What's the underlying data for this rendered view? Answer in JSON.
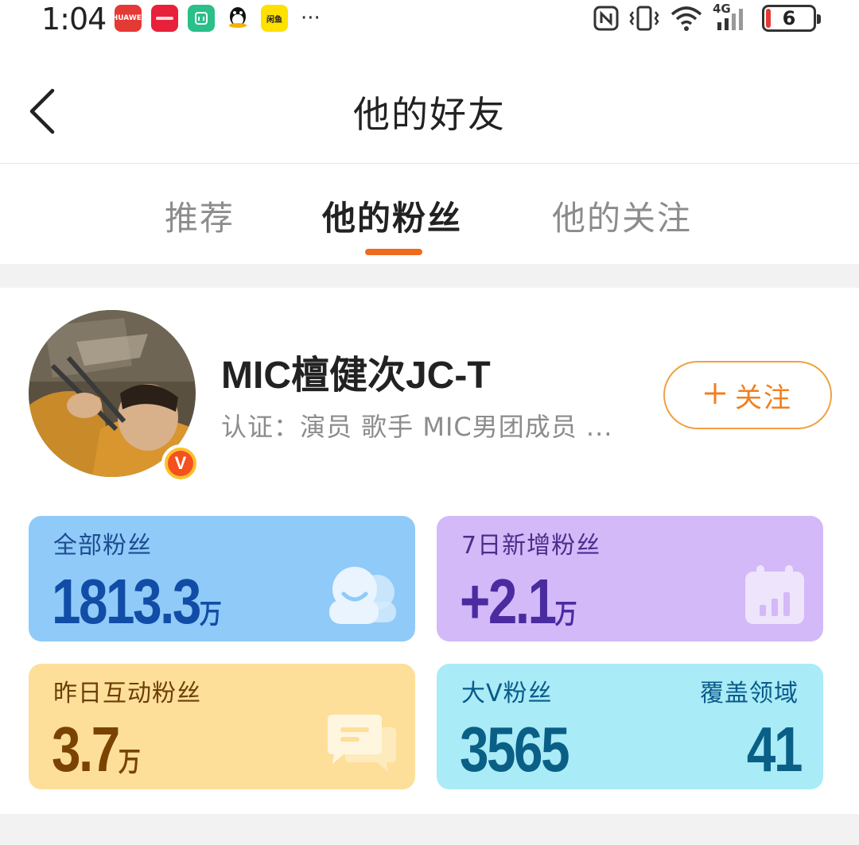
{
  "status_bar": {
    "time": "1:04",
    "app_icons": [
      {
        "name": "huawei-appgallery-icon",
        "color": "#e53935",
        "label": "HUAWEI"
      },
      {
        "name": "red-app-icon",
        "color": "#e8213b",
        "label": ""
      },
      {
        "name": "mijia-icon",
        "color": "#2bbf8a",
        "label": ""
      },
      {
        "name": "qq-icon",
        "color": "#ffffff",
        "label": ""
      },
      {
        "name": "xianyu-icon",
        "color": "#ffe100",
        "label": "闲鱼"
      }
    ],
    "more": "···",
    "network": "4G",
    "battery": "6"
  },
  "header": {
    "title": "他的好友"
  },
  "tabs": [
    {
      "label": "推荐",
      "active": false
    },
    {
      "label": "他的粉丝",
      "active": true
    },
    {
      "label": "他的关注",
      "active": false
    }
  ],
  "profile": {
    "name": "MIC檀健次JC-T",
    "verification": "认证：演员 歌手 MIC男团成员 ...",
    "badge": "V",
    "follow_label": "关注"
  },
  "stats": {
    "all_fans": {
      "label": "全部粉丝",
      "value": "1813.3",
      "unit": "万"
    },
    "new_fans_7d": {
      "label": "7日新增粉丝",
      "value": "+2.1",
      "unit": "万"
    },
    "interactive_fans": {
      "label": "昨日互动粉丝",
      "value": "3.7",
      "unit": "万"
    },
    "big_v_fans": {
      "label": "大V粉丝",
      "value": "3565",
      "coverage_label": "覆盖领域",
      "coverage_value": "41"
    }
  },
  "colors": {
    "accent": "#f06a1f",
    "follow_border": "#f0a040",
    "card_blue": "#8fcaf9",
    "card_purple": "#d3b9f8",
    "card_yellow": "#fddf9a",
    "card_cyan": "#a9ebf6"
  }
}
